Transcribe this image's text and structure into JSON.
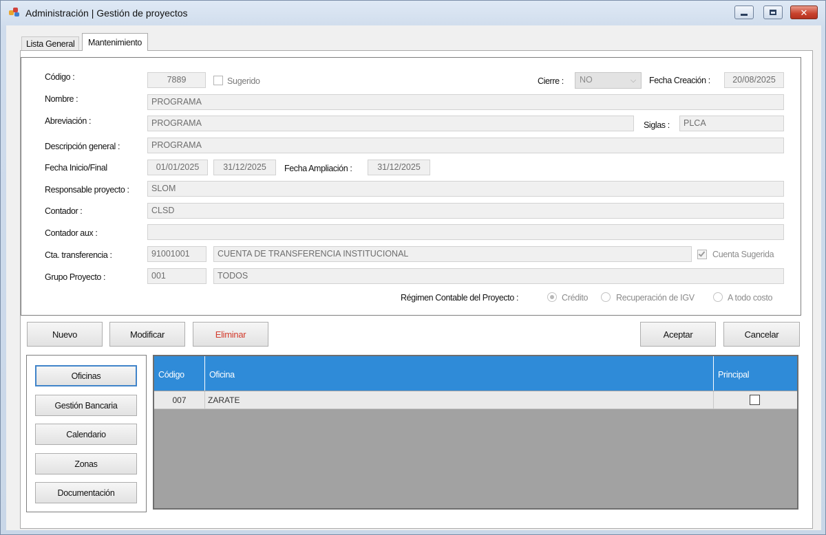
{
  "window": {
    "title": "Administración | Gestión de proyectos",
    "close_glyph": "✕"
  },
  "tabs": [
    {
      "label": "Lista General",
      "active": false
    },
    {
      "label": "Mantenimiento",
      "active": true
    }
  ],
  "form": {
    "codigo": {
      "label": "Código :",
      "value": "7889"
    },
    "sugerido": {
      "label": "Sugerido",
      "checked": false
    },
    "cierre": {
      "label": "Cierre :",
      "value": "NO"
    },
    "fecha_creacion": {
      "label": "Fecha Creación :",
      "value": "20/08/2025"
    },
    "nombre": {
      "label": "Nombre :",
      "value": "PROGRAMA"
    },
    "abreviacion": {
      "label": "Abreviación :",
      "value": "PROGRAMA"
    },
    "siglas": {
      "label": "Siglas :",
      "value": "PLCA"
    },
    "descripcion": {
      "label": "Descripción general :",
      "value": "PROGRAMA"
    },
    "fecha_inicio_final": {
      "label": "Fecha Inicio/Final",
      "inicio": "01/01/2025",
      "final": "31/12/2025"
    },
    "fecha_ampliacion": {
      "label": "Fecha Ampliación :",
      "value": "31/12/2025"
    },
    "responsable": {
      "label": "Responsable proyecto :",
      "value": "SLOM"
    },
    "contador": {
      "label": "Contador :",
      "value": "CLSD"
    },
    "contador_aux": {
      "label": "Contador aux :",
      "value": ""
    },
    "cta_transferencia": {
      "label": "Cta. transferencia :",
      "code": "91001001",
      "name": "CUENTA DE TRANSFERENCIA INSTITUCIONAL"
    },
    "cuenta_sugerida": {
      "label": "Cuenta Sugerida",
      "checked": true
    },
    "grupo_proyecto": {
      "label": "Grupo Proyecto :",
      "code": "001",
      "name": "TODOS"
    },
    "regimen": {
      "label": "Régimen Contable del Proyecto :",
      "options": [
        "Crédito",
        "Recuperación de IGV",
        "A todo costo"
      ],
      "selected": "Crédito"
    }
  },
  "actions": {
    "nuevo": "Nuevo",
    "modificar": "Modificar",
    "eliminar": "Eliminar",
    "aceptar": "Aceptar",
    "cancelar": "Cancelar"
  },
  "side_buttons": [
    "Oficinas",
    "Gestión Bancaria",
    "Calendario",
    "Zonas",
    "Documentación"
  ],
  "side_active": "Oficinas",
  "grid": {
    "columns": [
      "Código",
      "Oficina",
      "Principal"
    ],
    "rows": [
      {
        "codigo": "007",
        "oficina": "ZARATE",
        "principal": false
      }
    ]
  },
  "colors": {
    "grid_header": "#2f8bd8",
    "grid_body": "#a2a2a2",
    "delete_text": "#d33b2c",
    "active_border": "#3f83c9"
  }
}
